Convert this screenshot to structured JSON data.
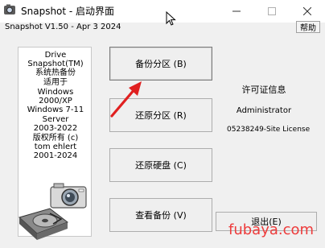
{
  "window": {
    "title": "Snapshot - 启动界面",
    "icons": {
      "app": "snapshot-app-icon",
      "minimize": "minimize-icon",
      "maximize": "maximize-icon",
      "close": "close-icon"
    }
  },
  "header": {
    "version": "Snapshot V1.50 - Apr  3 2024",
    "help_label": "帮助"
  },
  "info_panel": {
    "lines": [
      "Drive",
      "Snapshot(TM)",
      "系统热备份",
      "适用于",
      "Windows",
      "2000/XP",
      "Windows 7-11",
      "Server",
      "2003-2022",
      "版权所有 (c)",
      "tom ehlert",
      "2001-2024"
    ]
  },
  "actions": [
    {
      "label": "备份分区 (B)"
    },
    {
      "label": "还原分区 (R)"
    },
    {
      "label": "还原硬盘 (C)"
    },
    {
      "label": "查看备份 (V)"
    }
  ],
  "license": {
    "title": "许可证信息",
    "user": "Administrator",
    "key": "05238249-Site License"
  },
  "exit_label": "退出(E)",
  "watermark": "fubaya.com",
  "colors": {
    "arrow": "#e02020",
    "watermark": "#ee3b3b"
  }
}
